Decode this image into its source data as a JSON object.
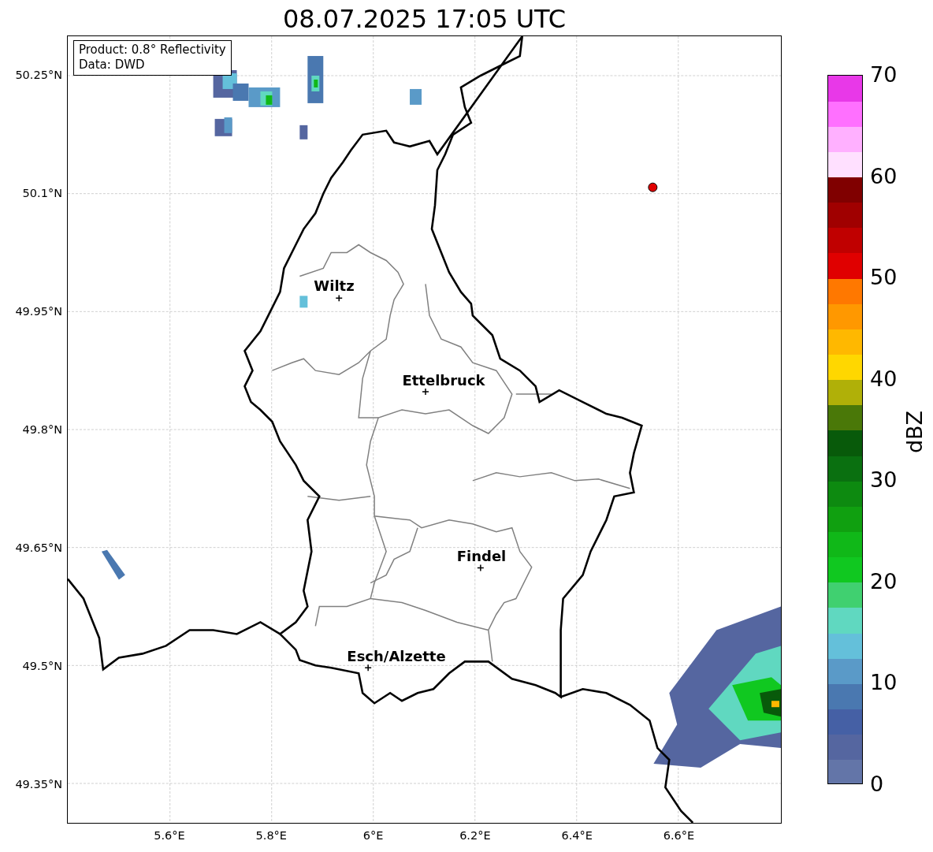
{
  "title": "08.07.2025 17:05 UTC",
  "info_box": {
    "lines": [
      "Product: 0.8° Reflectivity",
      "Data: DWD"
    ]
  },
  "map": {
    "y_ticks": [
      "50.25°N",
      "50.1°N",
      "49.95°N",
      "49.8°N",
      "49.65°N",
      "49.5°N",
      "49.35°N"
    ],
    "x_ticks": [
      "5.6°E",
      "5.8°E",
      "6°E",
      "6.2°E",
      "6.4°E",
      "6.6°E"
    ],
    "cities": [
      {
        "name": "Wiltz"
      },
      {
        "name": "Ettelbruck"
      },
      {
        "name": "Findel"
      },
      {
        "name": "Esch/Alzette"
      }
    ]
  },
  "colorbar": {
    "label": "dBZ",
    "ticks": [
      "70",
      "60",
      "50",
      "40",
      "30",
      "20",
      "10",
      "0"
    ],
    "segments": [
      {
        "color": "#6375a8"
      },
      {
        "color": "#5566a0"
      },
      {
        "color": "#4560a5"
      },
      {
        "color": "#4a78b0"
      },
      {
        "color": "#5a9ac8"
      },
      {
        "color": "#64c0da"
      },
      {
        "color": "#60d8c0"
      },
      {
        "color": "#40d070"
      },
      {
        "color": "#10c820"
      },
      {
        "color": "#10b818"
      },
      {
        "color": "#10a010"
      },
      {
        "color": "#0d8a10"
      },
      {
        "color": "#0a7010"
      },
      {
        "color": "#085a0a"
      },
      {
        "color": "#4a7808"
      },
      {
        "color": "#b0b008"
      },
      {
        "color": "#ffd700"
      },
      {
        "color": "#ffb800"
      },
      {
        "color": "#ff9800"
      },
      {
        "color": "#ff7800"
      },
      {
        "color": "#e00000"
      },
      {
        "color": "#c00000"
      },
      {
        "color": "#a00000"
      },
      {
        "color": "#800000"
      },
      {
        "color": "#ffe0ff"
      },
      {
        "color": "#ffb0ff"
      },
      {
        "color": "#ff70ff"
      },
      {
        "color": "#e838e8"
      }
    ]
  }
}
